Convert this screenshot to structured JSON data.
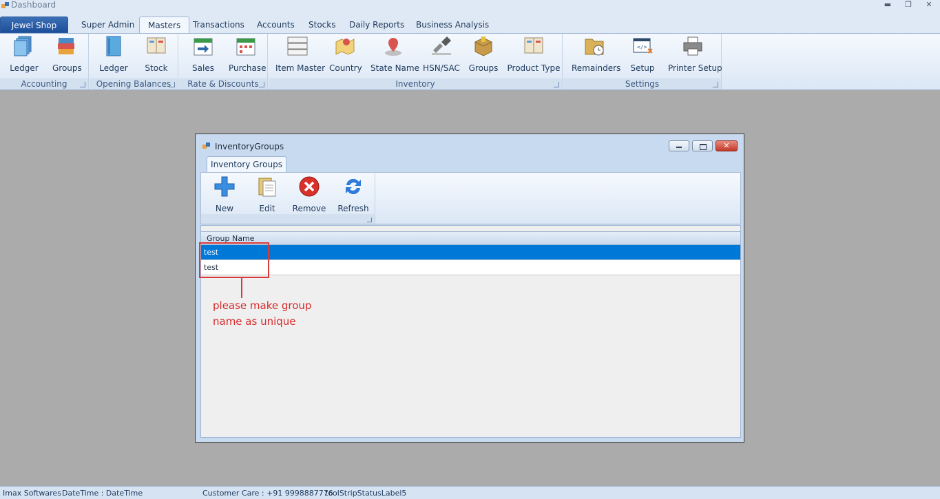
{
  "window": {
    "title": "Dashboard"
  },
  "tabs": {
    "app": "Jewel Shop",
    "items": [
      "Super Admin",
      "Masters",
      "Transactions",
      "Accounts",
      "Stocks",
      "Daily Reports",
      "Business Analysis"
    ],
    "active": "Masters"
  },
  "ribbon": {
    "accounting": {
      "caption": "Accounting",
      "ledger": "Ledger",
      "groups": "Groups"
    },
    "opening_balances": {
      "caption": "Opening Balances",
      "ledger": "Ledger",
      "stock": "Stock"
    },
    "rate_discounts": {
      "caption": "Rate & Discounts",
      "sales": "Sales",
      "purchase": "Purchase"
    },
    "inventory": {
      "caption": "Inventory",
      "item_master": "Item Master",
      "country": "Country",
      "state_name": "State Name",
      "hsn_sac": "HSN/SAC",
      "groups": "Groups",
      "product_type": "Product Type"
    },
    "settings": {
      "caption": "Settings",
      "remainders": "Remainders",
      "setup": "Setup",
      "printer_setup": "Printer Setup"
    }
  },
  "child": {
    "title": "InventoryGroups",
    "tab": "Inventory Groups",
    "toolbar": {
      "new": "New",
      "edit": "Edit",
      "remove": "Remove",
      "refresh": "Refresh"
    },
    "grid": {
      "column": "Group Name",
      "rows": [
        "test",
        "test"
      ]
    }
  },
  "annotation": {
    "line1": "please make group",
    "line2": "name as unique"
  },
  "status": {
    "company": "Imax Softwares",
    "datetime": "DateTime  : DateTime",
    "care": "Customer Care : +91 9998887776",
    "label5": "toolStripStatusLabel5"
  },
  "colors": {
    "accent": "#0078d7",
    "annotation": "#d93a3a",
    "ribbon_bg": "#dbe7f5"
  }
}
